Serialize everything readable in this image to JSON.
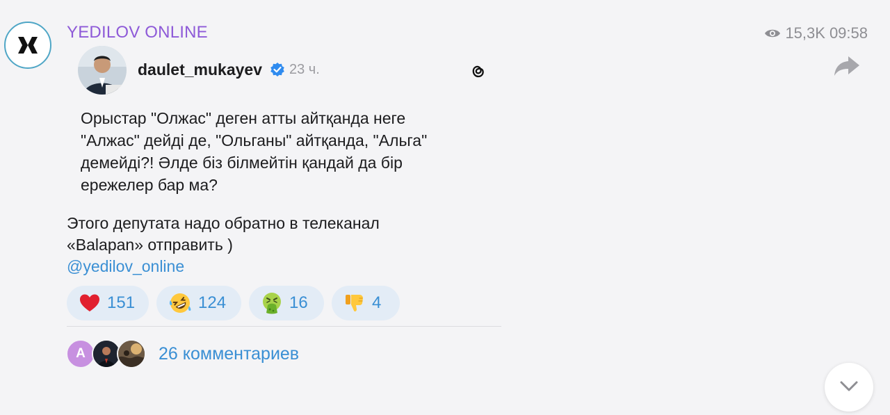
{
  "channel": {
    "name": "YEDILOV ONLINE",
    "views": "15,3K",
    "time": "09:58"
  },
  "repost": {
    "username": "daulet_mukayev",
    "time_ago": "23 ч.",
    "text_lines": [
      "Орыстар \"Олжас\" деген атты айтқанда неге",
      "\"Алжас\" дейді де, \"Ольганы\" айтқанда, \"Альга\"",
      "демейді?! Әлде біз білмейтін қандай да бір",
      "ережелер бар ма?"
    ]
  },
  "post": {
    "comment_line1": "Этого депутата надо обратно в телеканал",
    "comment_line2": "«Balapan» отправить )",
    "link": "@yedilov_online"
  },
  "reactions": [
    {
      "icon": "heart-icon",
      "count": "151"
    },
    {
      "icon": "rofl-face-icon",
      "count": "124"
    },
    {
      "icon": "vomit-face-icon",
      "count": "16"
    },
    {
      "icon": "thumbs-down-icon",
      "count": "4"
    }
  ],
  "comments": {
    "avatar_letter": "A",
    "label": "26 комментариев"
  },
  "colors": {
    "channel_name": "#8e5ad8",
    "link": "#3a8fd4",
    "reaction_bg": "#e3ecf6",
    "background": "#f4f4f6"
  }
}
